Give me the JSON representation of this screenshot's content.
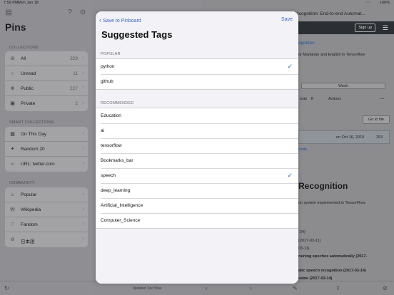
{
  "status": {
    "time": "7:59 PM",
    "date": "Mon Jan 18",
    "battery": "100%"
  },
  "sidebar": {
    "title": "Pins",
    "collections_header": "COLLECTIONS",
    "collections": [
      {
        "label": "All",
        "count": "229",
        "icon": "list-icon"
      },
      {
        "label": "Unread",
        "count": "11",
        "icon": "circle-icon"
      },
      {
        "label": "Public",
        "count": "227",
        "icon": "globe-icon"
      },
      {
        "label": "Private",
        "count": "2",
        "icon": "lock-icon"
      }
    ],
    "smart_header": "SMART COLLECTIONS",
    "smart": [
      {
        "label": "On This Day",
        "icon": "calendar-icon"
      },
      {
        "label": "Random 20",
        "icon": "sparkle-icon"
      },
      {
        "label": "URL: twitter.com",
        "icon": "search-icon"
      }
    ],
    "community_header": "COMMUNITY",
    "community": [
      {
        "label": "Popular",
        "icon": "flame-icon"
      },
      {
        "label": "Wikipedia",
        "icon": "wikipedia-icon"
      },
      {
        "label": "Fandom",
        "icon": "heart-icon"
      },
      {
        "label": "日本語",
        "icon": "japanese-icon"
      }
    ]
  },
  "midcol": {
    "updated": "Updated Just Now"
  },
  "detail": {
    "title_fragment": "ch_Recognition: End-to-end Automat...",
    "signup": "Sign up",
    "link": "ognition",
    "desc": "or Madarian and English in Tensorflow",
    "watch": "Watch",
    "tabs_text": "ests",
    "pr_count": "8",
    "actions": "Actions",
    "goto_file": "Go to file",
    "commit_date": "on Oct 16, 2019",
    "commit_count": "253",
    "code": "code",
    "readme_heading": "Recognition",
    "readme_desc": "on system implemented in TensorFlow.",
    "bullets": [
      "-24)",
      "(2017-03-11)",
      "03-11)",
      "raining epoches automatically (2017-",
      "atic speech recognition (2017-03-14)",
      "sable (2017-03-14)"
    ]
  },
  "modal": {
    "back_label": "Save to Pinboard",
    "save_label": "Save",
    "title": "Suggested Tags",
    "popular_header": "POPULAR",
    "popular": [
      {
        "label": "python",
        "checked": true
      },
      {
        "label": "github",
        "checked": false
      }
    ],
    "recommended_header": "RECOMMENDED",
    "recommended": [
      {
        "label": "Education",
        "checked": false
      },
      {
        "label": "ai",
        "checked": false
      },
      {
        "label": "tensorflow",
        "checked": false
      },
      {
        "label": "Bookmarks_bar",
        "checked": false
      },
      {
        "label": "speech",
        "checked": true
      },
      {
        "label": "deep_learning",
        "checked": false
      },
      {
        "label": "Artificial_Intelligence",
        "checked": false
      },
      {
        "label": "Computer_Science",
        "checked": false
      }
    ],
    "checkmark": "✓"
  },
  "colors": {
    "accent": "#3a63d6"
  }
}
